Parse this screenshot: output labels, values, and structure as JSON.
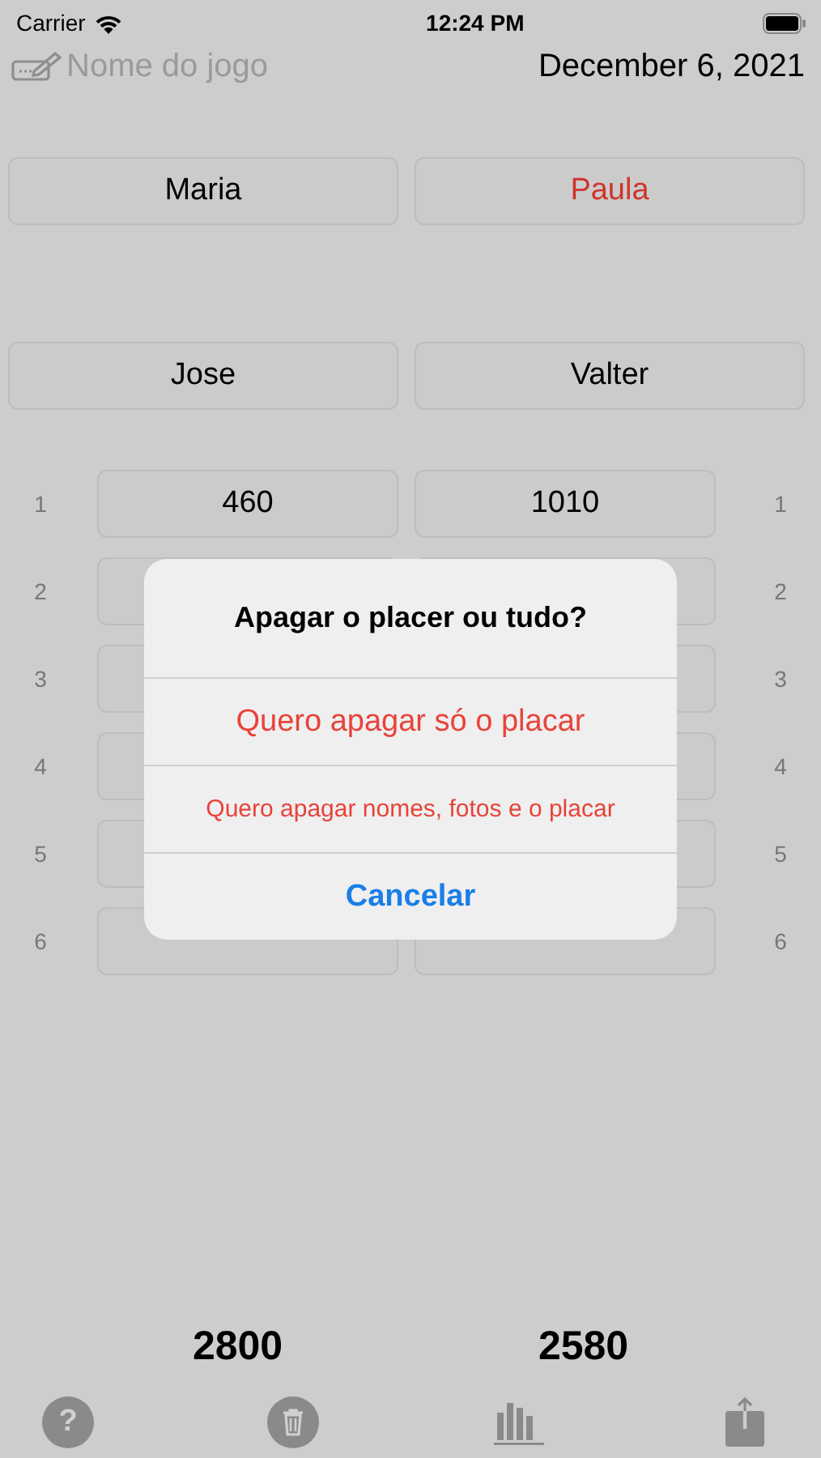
{
  "status_bar": {
    "carrier": "Carrier",
    "time": "12:24 PM"
  },
  "header": {
    "game_name_placeholder": "Nome do jogo",
    "date": "December 6, 2021"
  },
  "players": [
    {
      "name": "Maria",
      "selected": false
    },
    {
      "name": "Paula",
      "selected": true
    },
    {
      "name": "Jose",
      "selected": false
    },
    {
      "name": "Valter",
      "selected": false
    }
  ],
  "rounds": [
    {
      "left_number": "1",
      "right_number": "1",
      "scores": [
        "460",
        "1010"
      ]
    },
    {
      "left_number": "2",
      "right_number": "2"
    },
    {
      "left_number": "3",
      "right_number": "3"
    },
    {
      "left_number": "4",
      "right_number": "4"
    },
    {
      "left_number": "5",
      "right_number": "5"
    },
    {
      "left_number": "6",
      "right_number": "6"
    }
  ],
  "totals": [
    "2800",
    "2580"
  ],
  "toolbar": [
    {
      "kind": "help",
      "glyph": "?"
    },
    {
      "kind": "delete"
    },
    {
      "kind": "chart"
    },
    {
      "kind": "share"
    }
  ],
  "alert": {
    "title": "Apagar o placer ou tudo?",
    "actions": [
      {
        "label": "Quero apagar só o placar",
        "kind": "destructive"
      },
      {
        "label": "Quero apagar nomes, fotos e o placar",
        "kind": "destructive"
      },
      {
        "label": "Cancelar",
        "kind": "cancel"
      }
    ]
  }
}
